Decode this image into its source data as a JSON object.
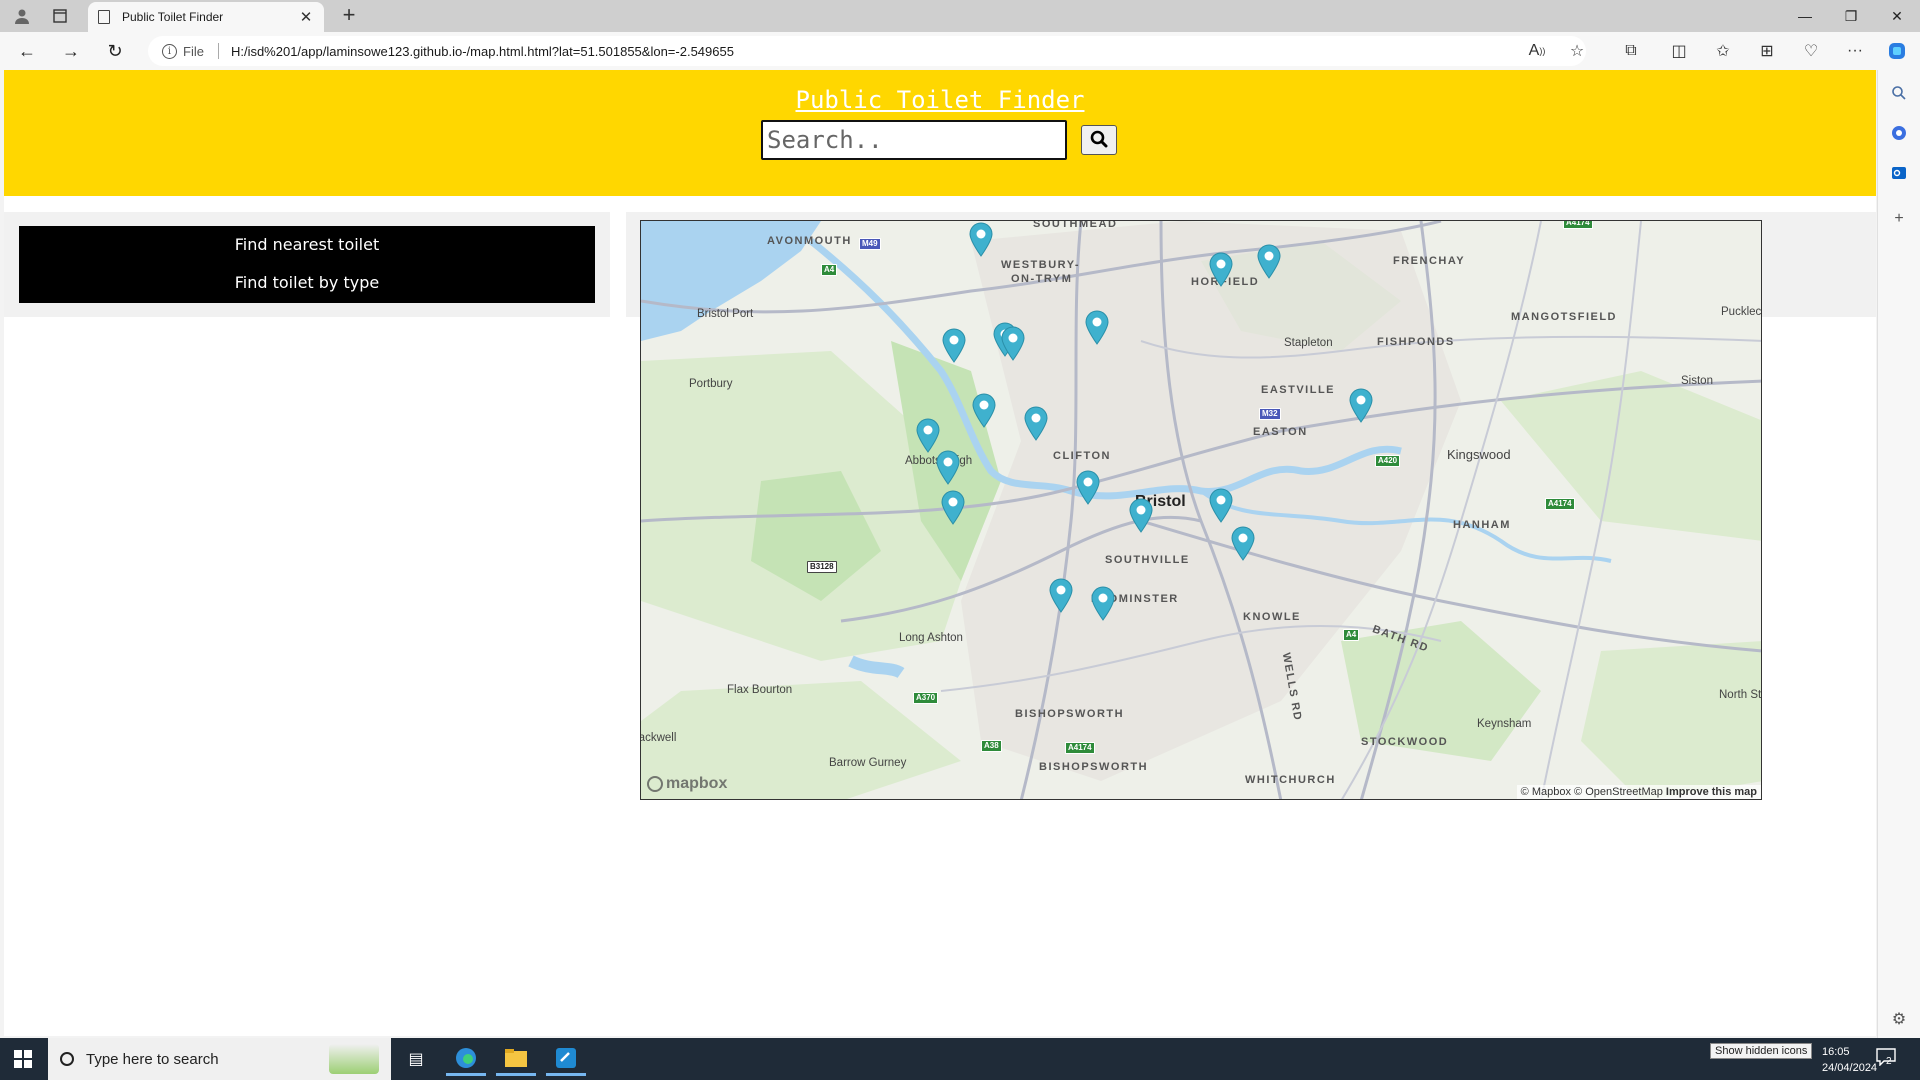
{
  "browser": {
    "tab_title": "Public Toilet Finder",
    "new_tab_label": "+",
    "url_scheme_label": "File",
    "url": "H:/isd%201/app/laminsowe123.github.io-/map.html.html?lat=51.501855&lon=-2.549655"
  },
  "header": {
    "title": "Public Toilet Finder",
    "search_placeholder": "Search.."
  },
  "menu": {
    "items": [
      "Find nearest toilet",
      "Find toilet by type"
    ]
  },
  "map": {
    "places": [
      "SOUTHMEAD",
      "AVONMOUTH",
      "WESTBURY-",
      "ON-TRYM",
      "HORFIELD",
      "FRENCHAY",
      "FISHPONDS",
      "MANGOTSFIELD",
      "Pucklechurch",
      "Bristol Port",
      "Stapleton",
      "Portbury",
      "EASTVILLE",
      "Siston",
      "EASTON",
      "Abbots Leigh",
      "CLIFTON",
      "Kingswood",
      "Bristol",
      "HANHAM",
      "SOUTHVILLE",
      "BEDMINSTER",
      "KNOWLE",
      "BATH RD",
      "WELLS RD",
      "Long Ashton",
      "Flax Bourton",
      "BISHOPSWORTH",
      "BISHOPSWORTH",
      "North Stoke",
      "Keynsham",
      "STOCKWOOD",
      "Barrow Gurney",
      "WHITCHURCH",
      "Backwell"
    ],
    "roads": [
      "A4174",
      "M49",
      "A4",
      "M32",
      "A420",
      "A4174",
      "B3128",
      "A4",
      "A370",
      "A38",
      "A4174"
    ],
    "attribution": {
      "mapbox": "© Mapbox",
      "osm": "© OpenStreetMap",
      "improve": "Improve this map"
    },
    "logo": "mapbox",
    "marker_count": 19,
    "colors": {
      "marker": "#3fb1ce",
      "water": "#aad3f0",
      "park": "#c5e3b5",
      "land": "#eef0e9"
    }
  },
  "taskbar": {
    "search_placeholder": "Type here to search",
    "tray_tooltip": "Show hidden icons",
    "time": "16:05",
    "date": "24/04/2024",
    "notifications": "2"
  },
  "colors": {
    "header_bg": "#ffd700",
    "menu_bg": "#000000"
  }
}
